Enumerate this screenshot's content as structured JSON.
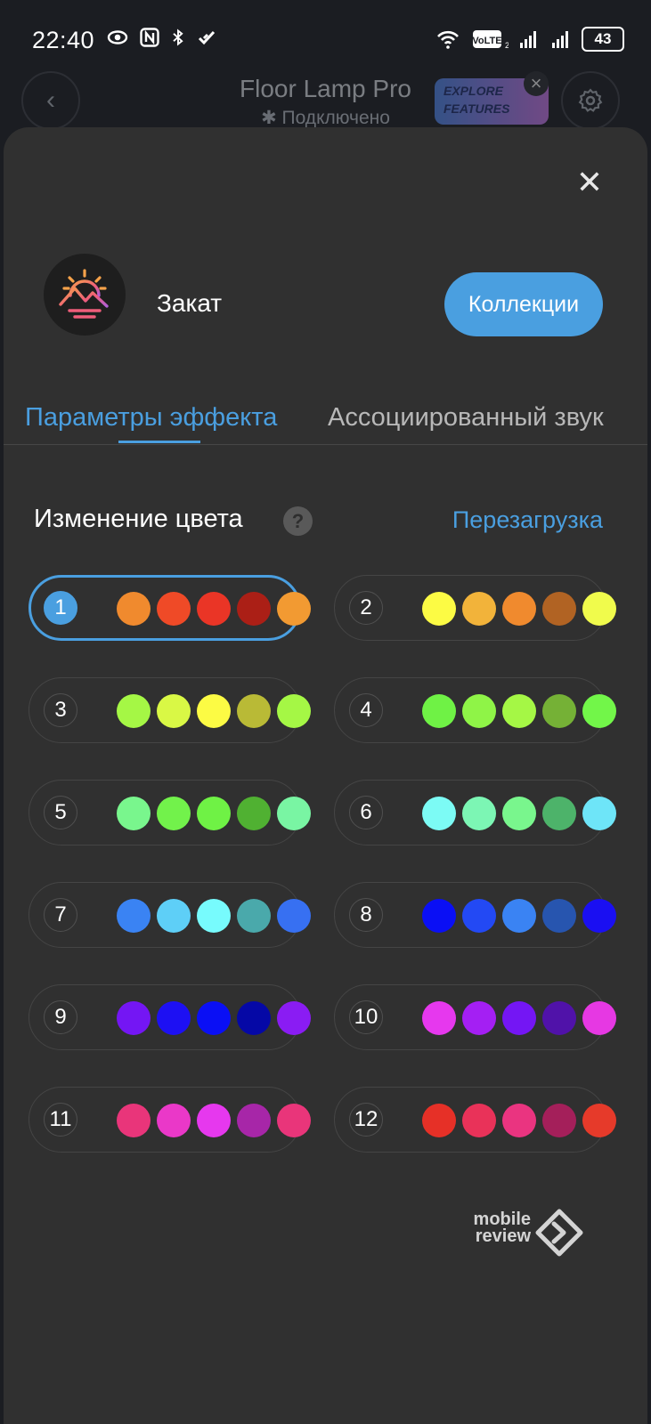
{
  "status_bar": {
    "time": "22:40",
    "battery": "43",
    "left_icons": [
      "eye-icon",
      "nfc-icon",
      "bluetooth-icon",
      "health-icon"
    ],
    "right_icons": [
      "wifi-icon",
      "volte-icon",
      "signal-icon",
      "signal-icon"
    ]
  },
  "header": {
    "title": "Floor Lamp Pro",
    "subtitle": "Подключено",
    "explore_line1": "EXPLORE",
    "explore_line2": "FEATURES"
  },
  "sheet": {
    "effect_name": "Закат",
    "collections_label": "Коллекции",
    "tabs": [
      {
        "label": "Параметры эффекта",
        "active": true
      },
      {
        "label": "Ассоциированный звук",
        "active": false
      }
    ],
    "section_title": "Изменение цвета",
    "help_label": "?",
    "reset_label": "Перезагрузка",
    "selected_palette": "1",
    "palettes": [
      {
        "label": "1",
        "colors": [
          "#f08a2e",
          "#ef4a27",
          "#ea3526",
          "#ab1f16",
          "#f29a32"
        ]
      },
      {
        "label": "2",
        "colors": [
          "#fcfb44",
          "#f2b33a",
          "#f08a2e",
          "#b16323",
          "#f0fb4c"
        ]
      },
      {
        "label": "3",
        "colors": [
          "#a5f745",
          "#d9f845",
          "#fcfb44",
          "#b9ba36",
          "#a5f745"
        ]
      },
      {
        "label": "4",
        "colors": [
          "#6ff245",
          "#8ff447",
          "#a5f745",
          "#75b136",
          "#72f649"
        ]
      },
      {
        "label": "5",
        "colors": [
          "#79f68d",
          "#72f24b",
          "#6ff245",
          "#50b132",
          "#79f5a3"
        ]
      },
      {
        "label": "6",
        "colors": [
          "#7cfbf5",
          "#7cf6b4",
          "#79f68d",
          "#4db36a",
          "#6ee5f8"
        ]
      },
      {
        "label": "7",
        "colors": [
          "#3a83f3",
          "#5ecff7",
          "#77fbfd",
          "#4aa9ab",
          "#3770f2"
        ]
      },
      {
        "label": "8",
        "colors": [
          "#0a0ff5",
          "#2349f4",
          "#3a83f3",
          "#2755af",
          "#1a0ff2"
        ]
      },
      {
        "label": "9",
        "colors": [
          "#7416f4",
          "#1d10f3",
          "#0a0ff5",
          "#0508a6",
          "#8a1cf3"
        ]
      },
      {
        "label": "10",
        "colors": [
          "#e638ee",
          "#a41ff3",
          "#7416f4",
          "#5012a9",
          "#e638e3"
        ]
      },
      {
        "label": "11",
        "colors": [
          "#e9357a",
          "#ea38c8",
          "#e638ee",
          "#a726a8",
          "#e9357a"
        ]
      },
      {
        "label": "12",
        "colors": [
          "#e63027",
          "#e93259",
          "#ea3480",
          "#a41f5a",
          "#e63a2a"
        ]
      }
    ]
  },
  "watermark": {
    "line1": "mobile",
    "line2": "review"
  },
  "colors": {
    "accent": "#4a9fe0",
    "sheet_bg": "#303030",
    "page_bg": "#1b1d22"
  }
}
